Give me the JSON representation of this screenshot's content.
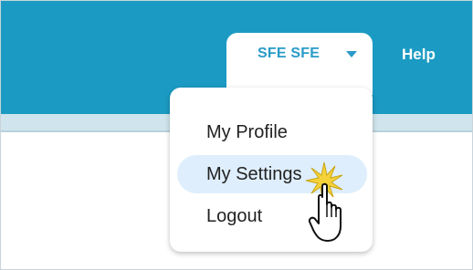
{
  "header": {
    "user_menu_label": "SFE SFE",
    "help_label": "Help"
  },
  "user_menu": {
    "items": [
      {
        "label": "My Profile"
      },
      {
        "label": "My Settings",
        "highlighted": true
      },
      {
        "label": "Logout"
      }
    ]
  },
  "colors": {
    "header_bg": "#1b9bc3",
    "accent": "#2a9bc8",
    "highlight_bg": "#deeefc"
  },
  "icons": [
    "chevron-down-icon",
    "hand-pointer-cursor-icon"
  ]
}
